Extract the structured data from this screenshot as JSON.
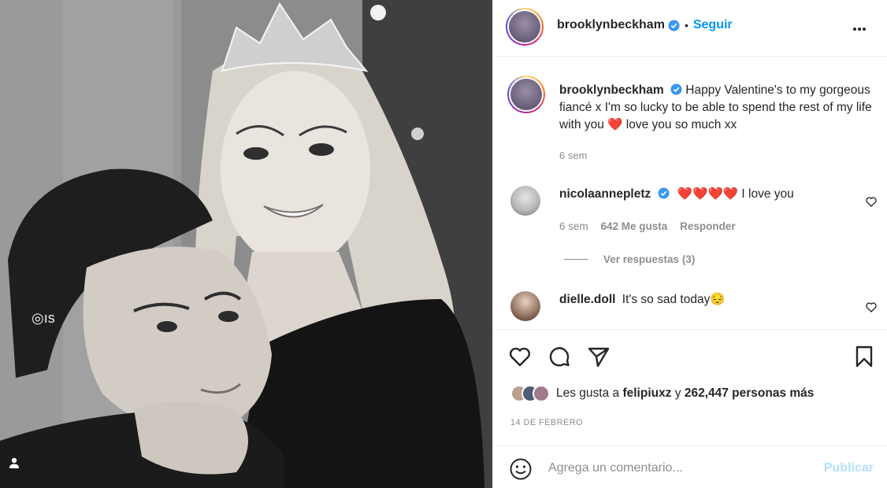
{
  "post": {
    "author": "brooklynbeckham",
    "separator": "•",
    "follow_label": "Seguir",
    "more_icon": "more-options-icon",
    "caption": {
      "author": "brooklynbeckham",
      "text_a": "Happy Valentine's to my gorgeous fiancé x I'm so lucky to be able to spend the rest of my life with you ",
      "heart_emoji": "❤️",
      "text_b": " love you so much xx",
      "time": "6 sem"
    },
    "comments": [
      {
        "author": "nicolaannepletz",
        "verified": true,
        "hearts": "❤️❤️❤️❤️",
        "text": " I love you",
        "time": "6 sem",
        "likes": "642 Me gusta",
        "reply_label": "Responder",
        "view_replies": "Ver respuestas (3)"
      },
      {
        "author": "dielle.doll",
        "verified": false,
        "text": "It's so sad today",
        "emoji": "😔"
      }
    ],
    "likes": {
      "prefix": "Les gusta a ",
      "first_user": "felipiuxz",
      "middle": " y ",
      "others": "262,447 personas más"
    },
    "date": "14 DE FEBRERO",
    "comment_box": {
      "placeholder": "Agrega un comentario...",
      "publish_label": "Publicar"
    }
  },
  "colors": {
    "accent": "#0095f6",
    "publish_disabled": "#b2dffc",
    "muted": "#8e8e8e",
    "text": "#262626",
    "heart": "#e0245e"
  }
}
